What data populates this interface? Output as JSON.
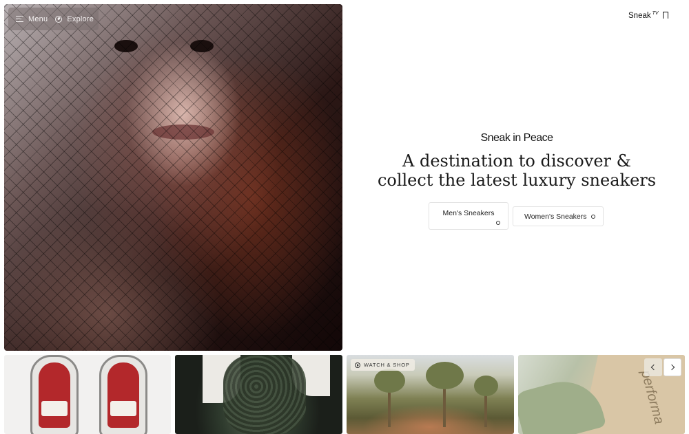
{
  "nav": {
    "menu_label": "Menu",
    "explore_label": "Explore"
  },
  "brand": {
    "name": "Sneak",
    "superscript": "TV"
  },
  "hero": {
    "logo_text": "Sneak in Peace",
    "headline": "A destination to discover & collect the latest luxury sneakers",
    "buttons": {
      "mens": "Men's Sneakers",
      "womens": "Women's Sneakers"
    }
  },
  "carousel": {
    "badge_label": "WATCH & SHOP",
    "thumb_4_text": "performa"
  },
  "icons": {
    "menu": "menu-icon",
    "explore": "compass-icon",
    "bookmark": "bookmark-icon",
    "play": "play-icon",
    "prev": "chevron-left-icon",
    "next": "chevron-right-icon"
  }
}
